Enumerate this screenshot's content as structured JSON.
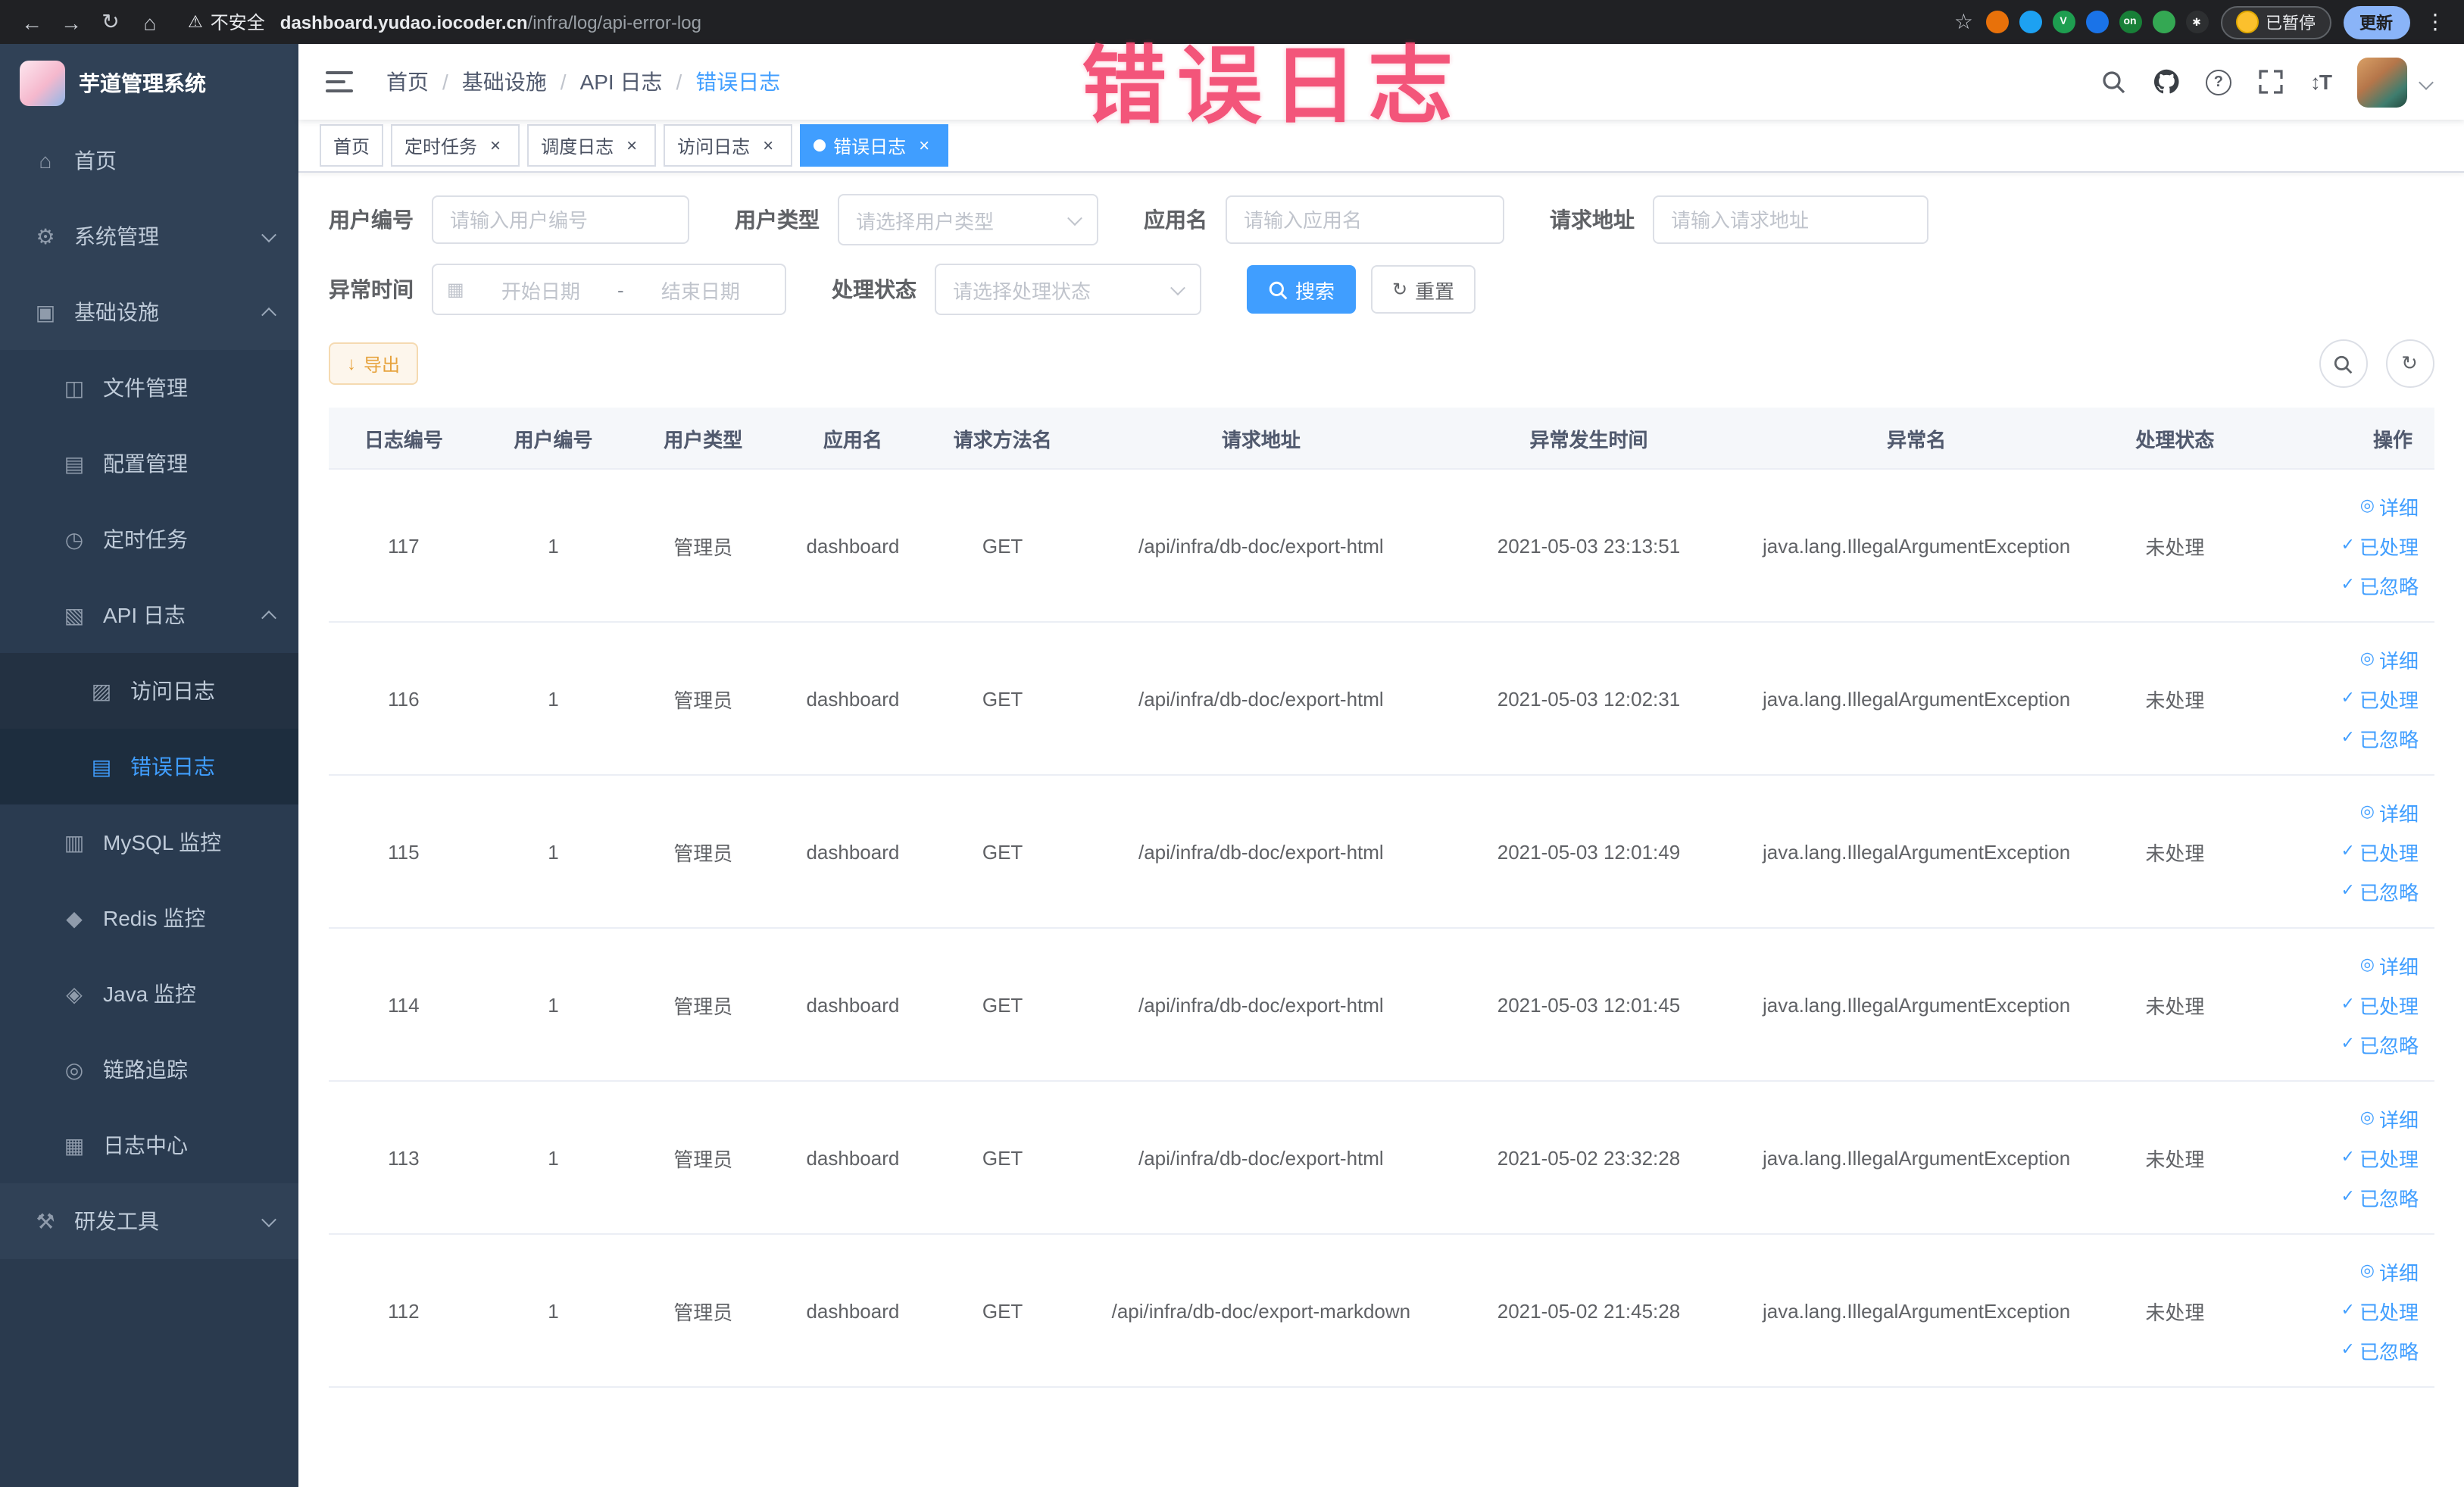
{
  "annotation": {
    "text": "错误日志"
  },
  "browser": {
    "security_label": "不安全",
    "url_host": "dashboard.yudao.iocoder.cn",
    "url_path": "/infra/log/api-error-log",
    "paused_label": "已暂停",
    "update_label": "更新",
    "extensions": [
      {
        "name": "extension-orange",
        "color": "#e8710a",
        "glyph": ""
      },
      {
        "name": "extension-drop",
        "color": "#1da1f2",
        "glyph": ""
      },
      {
        "name": "extension-green-v",
        "color": "#1e9e50",
        "glyph": "V"
      },
      {
        "name": "extension-grid",
        "color": "#1a73e8",
        "glyph": ""
      },
      {
        "name": "extension-on",
        "color": "#188038",
        "glyph": "on"
      },
      {
        "name": "extension-leaf",
        "color": "#34a853",
        "glyph": ""
      },
      {
        "name": "extension-plugin",
        "color": "#2d2f31",
        "glyph": "✱"
      }
    ]
  },
  "sidebar": {
    "logo_title": "芋道管理系统",
    "items": [
      {
        "label": "首页"
      },
      {
        "label": "系统管理"
      },
      {
        "label": "基础设施"
      },
      {
        "label": "文件管理"
      },
      {
        "label": "配置管理"
      },
      {
        "label": "定时任务"
      },
      {
        "label": "API 日志"
      },
      {
        "label": "访问日志"
      },
      {
        "label": "错误日志"
      },
      {
        "label": "MySQL 监控"
      },
      {
        "label": "Redis 监控"
      },
      {
        "label": "Java 监控"
      },
      {
        "label": "链路追踪"
      },
      {
        "label": "日志中心"
      },
      {
        "label": "研发工具"
      }
    ]
  },
  "breadcrumb": {
    "items": [
      "首页",
      "基础设施",
      "API 日志",
      "错误日志"
    ]
  },
  "tabs": [
    {
      "label": "首页"
    },
    {
      "label": "定时任务"
    },
    {
      "label": "调度日志"
    },
    {
      "label": "访问日志"
    },
    {
      "label": "错误日志"
    }
  ],
  "filters": {
    "user_id_label": "用户编号",
    "user_id_placeholder": "请输入用户编号",
    "user_type_label": "用户类型",
    "user_type_placeholder": "请选择用户类型",
    "app_name_label": "应用名",
    "app_name_placeholder": "请输入应用名",
    "request_url_label": "请求地址",
    "request_url_placeholder": "请输入请求地址",
    "exception_time_label": "异常时间",
    "start_placeholder": "开始日期",
    "end_placeholder": "结束日期",
    "range_separator": "-",
    "process_status_label": "处理状态",
    "process_status_placeholder": "请选择处理状态",
    "search_label": "搜索",
    "reset_label": "重置"
  },
  "toolbar": {
    "export_label": "导出"
  },
  "table": {
    "headers": [
      "日志编号",
      "用户编号",
      "用户类型",
      "应用名",
      "请求方法名",
      "请求地址",
      "异常发生时间",
      "异常名",
      "处理状态",
      "操作"
    ],
    "actions": [
      "详细",
      "已处理",
      "已忽略"
    ],
    "rows": [
      {
        "id": "117",
        "user_id": "1",
        "user_type": "管理员",
        "app": "dashboard",
        "method": "GET",
        "url": "/api/infra/db-doc/export-html",
        "time": "2021-05-03 23:13:51",
        "exception": "java.lang.IllegalArgumentException",
        "status": "未处理"
      },
      {
        "id": "116",
        "user_id": "1",
        "user_type": "管理员",
        "app": "dashboard",
        "method": "GET",
        "url": "/api/infra/db-doc/export-html",
        "time": "2021-05-03 12:02:31",
        "exception": "java.lang.IllegalArgumentException",
        "status": "未处理"
      },
      {
        "id": "115",
        "user_id": "1",
        "user_type": "管理员",
        "app": "dashboard",
        "method": "GET",
        "url": "/api/infra/db-doc/export-html",
        "time": "2021-05-03 12:01:49",
        "exception": "java.lang.IllegalArgumentException",
        "status": "未处理"
      },
      {
        "id": "114",
        "user_id": "1",
        "user_type": "管理员",
        "app": "dashboard",
        "method": "GET",
        "url": "/api/infra/db-doc/export-html",
        "time": "2021-05-03 12:01:45",
        "exception": "java.lang.IllegalArgumentException",
        "status": "未处理"
      },
      {
        "id": "113",
        "user_id": "1",
        "user_type": "管理员",
        "app": "dashboard",
        "method": "GET",
        "url": "/api/infra/db-doc/export-html",
        "time": "2021-05-02 23:32:28",
        "exception": "java.lang.IllegalArgumentException",
        "status": "未处理"
      },
      {
        "id": "112",
        "user_id": "1",
        "user_type": "管理员",
        "app": "dashboard",
        "method": "GET",
        "url": "/api/infra/db-doc/export-markdown",
        "time": "2021-05-02 21:45:28",
        "exception": "java.lang.IllegalArgumentException",
        "status": "未处理"
      }
    ]
  },
  "colors": {
    "accent": "#409eff",
    "warning": "#e6a23c",
    "sidebar": "#304156",
    "annotation": "#f3476f"
  },
  "icons": {
    "back": "←",
    "forward": "→",
    "reload": "↻",
    "home": "⌂",
    "warning": "⚠",
    "star": "☆",
    "kebab": "⋮",
    "close": "×",
    "question": "?",
    "font_size": "↕T",
    "menu_home": "⌂",
    "menu_gear": "⚙",
    "menu_infra": "▣",
    "menu_file": "◫",
    "menu_config": "▤",
    "menu_timer": "◷",
    "menu_api_log": "▧",
    "menu_access": "▨",
    "menu_error": "▤",
    "menu_mysql": "▥",
    "menu_redis": "◆",
    "menu_java": "◈",
    "menu_trace": "◎",
    "menu_log_center": "▦",
    "menu_tools": "⚒",
    "eye": "◎",
    "check": "✓",
    "refresh": "↻",
    "download": "↓",
    "calendar": "▦"
  }
}
